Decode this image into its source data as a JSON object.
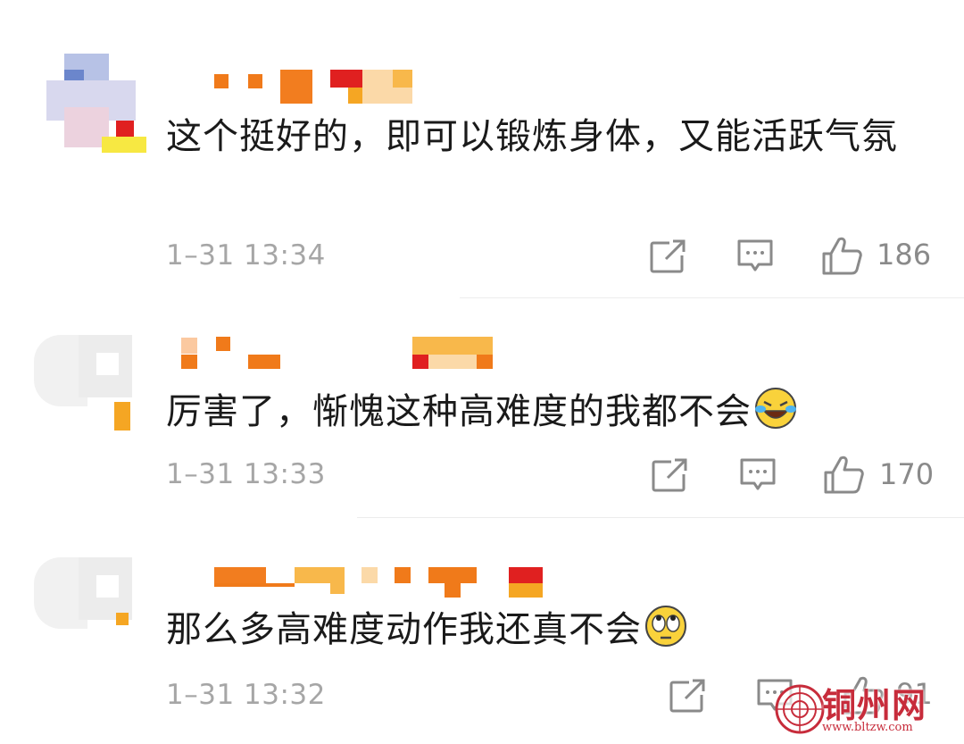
{
  "comments": [
    {
      "text": "这个挺好的，即可以锻炼身体，又能活跃气氛",
      "timestamp": "1–31 13:34",
      "likes": "186",
      "emoji": ""
    },
    {
      "text": "厉害了，惭愧这种高难度的我都不会",
      "timestamp": "1–31 13:33",
      "likes": "170",
      "emoji": "laughing-tears-emoji"
    },
    {
      "text": "那么多高难度动作我还真不会",
      "timestamp": "1–31 13:32",
      "likes": "91",
      "emoji": "rolling-eyes-emoji"
    }
  ],
  "icons": {
    "repost": "repost-icon",
    "reply": "reply-icon",
    "like": "thumbs-up-icon"
  },
  "colors": {
    "text": "#1a1a1a",
    "meta": "#a6a6a6",
    "username_mosaic": "#f07a1a",
    "watermark": "#c72c3b"
  },
  "watermark": {
    "title": "铜州网",
    "url": "www.bltzw.com"
  }
}
